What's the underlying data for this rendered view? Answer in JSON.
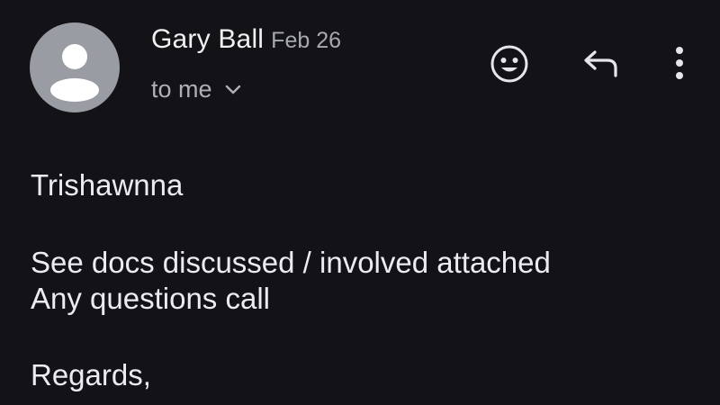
{
  "message": {
    "sender": {
      "name": "Gary Ball",
      "date": "Feb 26",
      "avatar_icon": "person-silhouette-icon",
      "avatar_color": "#9a9ca3"
    },
    "recipient": {
      "label": "to me",
      "expand_icon": "chevron-down-icon"
    },
    "actions": {
      "react_icon": "smiley-face-icon",
      "reply_icon": "reply-arrow-icon",
      "more_icon": "more-vertical-icon"
    },
    "body": {
      "greeting": "Trishawnna",
      "line1": "See docs discussed / involved attached",
      "line2": "Any questions call",
      "signoff": "Regards,"
    }
  },
  "theme": {
    "background": "#121217",
    "text_primary": "#ececf0",
    "text_secondary": "#a7a9b0"
  }
}
